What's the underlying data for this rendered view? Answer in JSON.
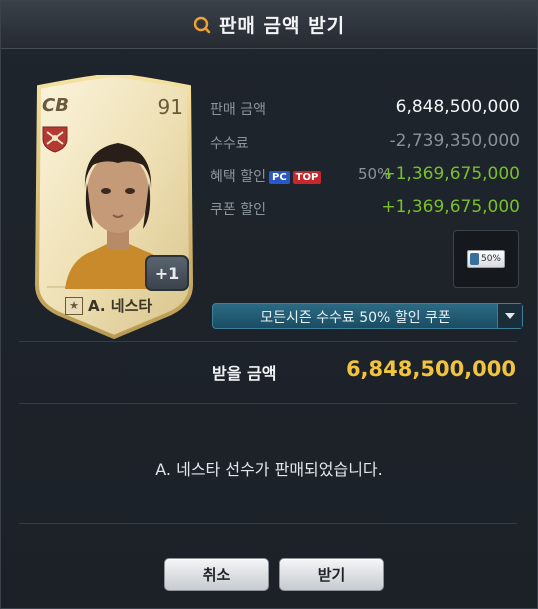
{
  "dialog": {
    "title": "판매 금액 받기"
  },
  "player": {
    "position": "CB",
    "overall": "91",
    "name": "A. 네스타",
    "enhance_badge": "+1"
  },
  "details": {
    "sale_amount_label": "판매 금액",
    "sale_amount_value": "6,848,500,000",
    "fee_label": "수수료",
    "fee_value": "-2,739,350,000",
    "benefit_label": "혜택 할인",
    "benefit_tag_pc": "PC",
    "benefit_tag_top": "TOP",
    "benefit_percent": "50%",
    "benefit_value": "+1,369,675,000",
    "coupon_label": "쿠폰 할인",
    "coupon_value": "+1,369,675,000",
    "coupon_thumb_text": "50%"
  },
  "coupon_select": {
    "selected": "모든시즌 수수료 50% 할인 쿠폰"
  },
  "receive": {
    "label": "받을 금액",
    "value": "6,848,500,000"
  },
  "message": "A. 네스타 선수가 판매되었습니다.",
  "buttons": {
    "cancel": "취소",
    "confirm": "받기"
  },
  "colors": {
    "accent_orange": "#f0a030",
    "value_green": "#78c02c",
    "receive_gold": "#f2c33c",
    "coupon_blue": "#1a4d63"
  }
}
